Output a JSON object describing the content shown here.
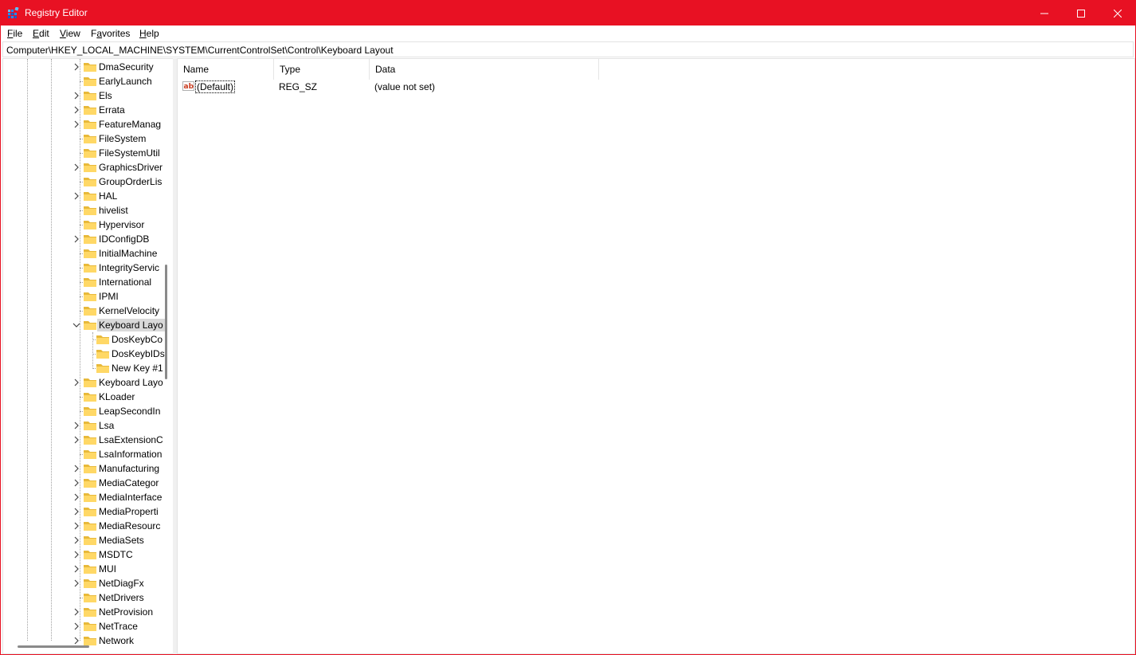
{
  "window": {
    "title": "Registry Editor",
    "accent_color": "#e81123"
  },
  "titlebar_buttons": {
    "minimize_icon": "minimize-icon",
    "maximize_icon": "maximize-icon",
    "close_icon": "close-icon"
  },
  "menu": {
    "items": [
      {
        "label": "File",
        "mnemonic": "F",
        "rest": "ile"
      },
      {
        "label": "Edit",
        "mnemonic": "E",
        "rest": "dit"
      },
      {
        "label": "View",
        "mnemonic": "V",
        "rest": "iew"
      },
      {
        "label": "Favorites",
        "mnemonic": "a",
        "prefix": "F",
        "rest": "vorites"
      },
      {
        "label": "Help",
        "mnemonic": "H",
        "rest": "elp"
      }
    ]
  },
  "address": {
    "path": "Computer\\HKEY_LOCAL_MACHINE\\SYSTEM\\CurrentControlSet\\Control\\Keyboard Layout"
  },
  "tree": {
    "items": [
      {
        "label": "DmaSecurity",
        "expandable": true
      },
      {
        "label": "EarlyLaunch",
        "expandable": false
      },
      {
        "label": "Els",
        "expandable": true
      },
      {
        "label": "Errata",
        "expandable": true
      },
      {
        "label": "FeatureManag",
        "expandable": true
      },
      {
        "label": "FileSystem",
        "expandable": false
      },
      {
        "label": "FileSystemUtil",
        "expandable": false
      },
      {
        "label": "GraphicsDriver",
        "expandable": true
      },
      {
        "label": "GroupOrderLis",
        "expandable": false
      },
      {
        "label": "HAL",
        "expandable": true
      },
      {
        "label": "hivelist",
        "expandable": false
      },
      {
        "label": "Hypervisor",
        "expandable": false
      },
      {
        "label": "IDConfigDB",
        "expandable": true
      },
      {
        "label": "InitialMachine",
        "expandable": false
      },
      {
        "label": "IntegrityServic",
        "expandable": false
      },
      {
        "label": "International",
        "expandable": false
      },
      {
        "label": "IPMI",
        "expandable": false
      },
      {
        "label": "KernelVelocity",
        "expandable": false
      },
      {
        "label": "Keyboard Layo",
        "expandable": true,
        "expanded": true,
        "selected": true
      },
      {
        "label": "DosKeybCo",
        "child": true
      },
      {
        "label": "DosKeybIDs",
        "child": true
      },
      {
        "label": "New Key #1",
        "child": true,
        "last_child": true
      },
      {
        "label": "Keyboard Layo",
        "expandable": true
      },
      {
        "label": "KLoader",
        "expandable": false
      },
      {
        "label": "LeapSecondIn",
        "expandable": false
      },
      {
        "label": "Lsa",
        "expandable": true
      },
      {
        "label": "LsaExtensionC",
        "expandable": true
      },
      {
        "label": "LsaInformation",
        "expandable": false
      },
      {
        "label": "Manufacturing",
        "expandable": true
      },
      {
        "label": "MediaCategor",
        "expandable": true
      },
      {
        "label": "MediaInterface",
        "expandable": true
      },
      {
        "label": "MediaProperti",
        "expandable": true
      },
      {
        "label": "MediaResourc",
        "expandable": true
      },
      {
        "label": "MediaSets",
        "expandable": true
      },
      {
        "label": "MSDTC",
        "expandable": true
      },
      {
        "label": "MUI",
        "expandable": true
      },
      {
        "label": "NetDiagFx",
        "expandable": true
      },
      {
        "label": "NetDrivers",
        "expandable": false
      },
      {
        "label": "NetProvision",
        "expandable": true
      },
      {
        "label": "NetTrace",
        "expandable": true
      },
      {
        "label": "Network",
        "expandable": true
      }
    ],
    "folder_color": "#ffd866"
  },
  "list": {
    "columns": [
      "Name",
      "Type",
      "Data"
    ],
    "rows": [
      {
        "name": "(Default)",
        "type": "REG_SZ",
        "data": "(value not set)",
        "icon": "string-value-icon"
      }
    ]
  }
}
